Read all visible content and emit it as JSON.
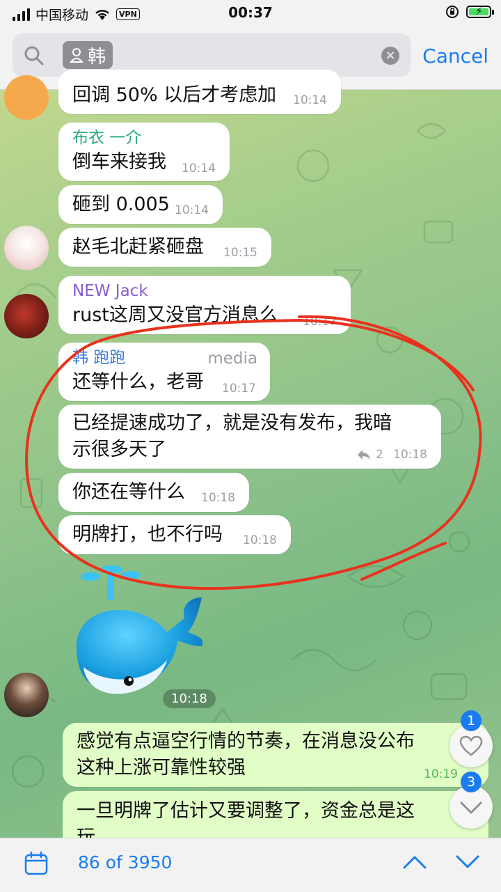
{
  "status_bar": {
    "carrier": "中国移动",
    "vpn": "VPN",
    "time": "00:37"
  },
  "search": {
    "chip_label": "韩",
    "cancel_label": "Cancel"
  },
  "messages": [
    {
      "text": "回调 50% 以后才考虑加",
      "time": "10:14"
    },
    {
      "sender": "布衣 一介",
      "text": "倒车来接我",
      "time": "10:14"
    },
    {
      "text": "砸到 0.005",
      "time": "10:14"
    },
    {
      "text": "赵毛北赶紧砸盘",
      "time": "10:15"
    },
    {
      "sender": "NEW Jack",
      "text": "rust这周又没官方消息么",
      "time": "10:17"
    },
    {
      "sender": "韩 跑跑",
      "tag": "media",
      "text": "还等什么，老哥",
      "time": "10:17"
    },
    {
      "text_line1": "已经提速成功了，就是没有发布，我暗",
      "text_line2": "示很多天了",
      "replies": "2",
      "time": "10:18"
    },
    {
      "text": "你还在等什么",
      "time": "10:18"
    },
    {
      "text": "明牌打，也不行吗",
      "time": "10:18"
    },
    {
      "sticker": "whale",
      "time": "10:18"
    },
    {
      "text_line1": "感觉有点逼空行情的节奏，在消息没公布",
      "text_line2": "这种上涨可靠性较强",
      "time": "10:19"
    },
    {
      "text_line1": "一旦明牌了估计又要调整了，资金总是这",
      "text_line2": "玩"
    }
  ],
  "fabs": {
    "reactions_badge": "1",
    "mentions_badge": "3"
  },
  "bottom": {
    "counter": "86 of 3950"
  },
  "colors": {
    "accent": "#1a7cf0",
    "annotation": "#e8321e",
    "name_green": "#2aa77e",
    "name_purple": "#8a5cd0",
    "name_blue": "#3d7bd9"
  }
}
